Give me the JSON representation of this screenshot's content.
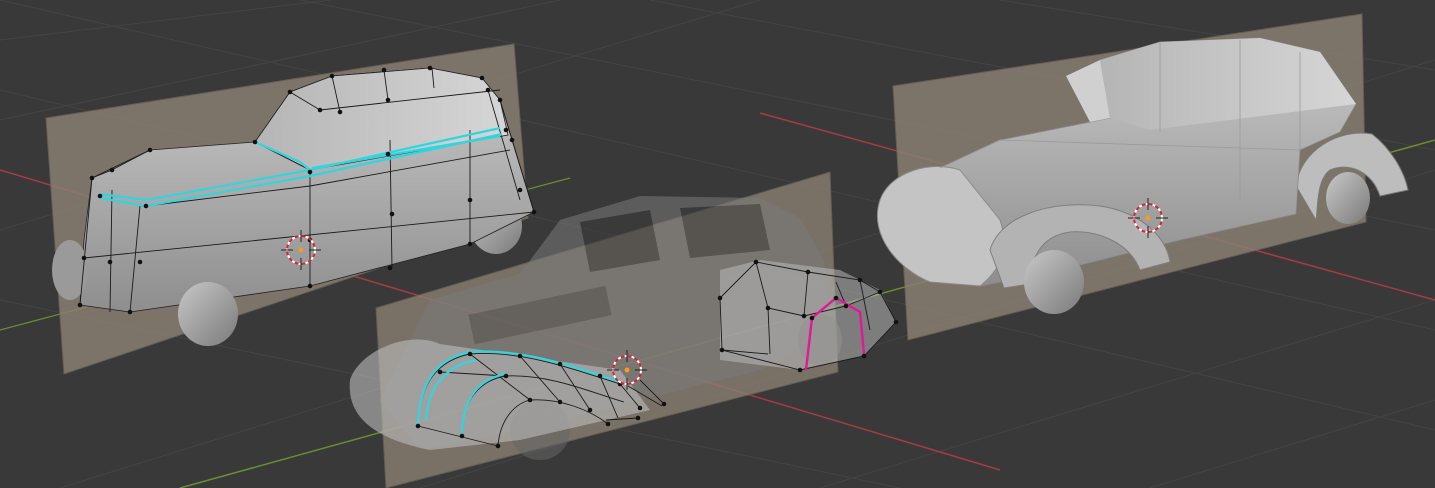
{
  "viewport": {
    "background_color": "#393939",
    "grid_color": "#4a4a4a",
    "axis_x_color": "#a83a47",
    "axis_y_color": "#6a8f2e"
  },
  "scene": {
    "reference_plane_color": "#8a7f72",
    "mesh_color": "#a7a7a7",
    "selected_edge_color": "#2fd6e0",
    "seam_edge_color": "#e0189a",
    "vertex_color": "#111111",
    "objects": [
      {
        "id": "car-left",
        "mode": "wireframe-edit",
        "icon": "car-mesh-icon"
      },
      {
        "id": "car-center",
        "mode": "x-ray-edit",
        "icon": "car-mesh-icon"
      },
      {
        "id": "car-right",
        "mode": "solid",
        "icon": "car-mesh-icon"
      }
    ],
    "cursor_icon": "3d-cursor-icon",
    "origin_color": "#f59a23"
  }
}
